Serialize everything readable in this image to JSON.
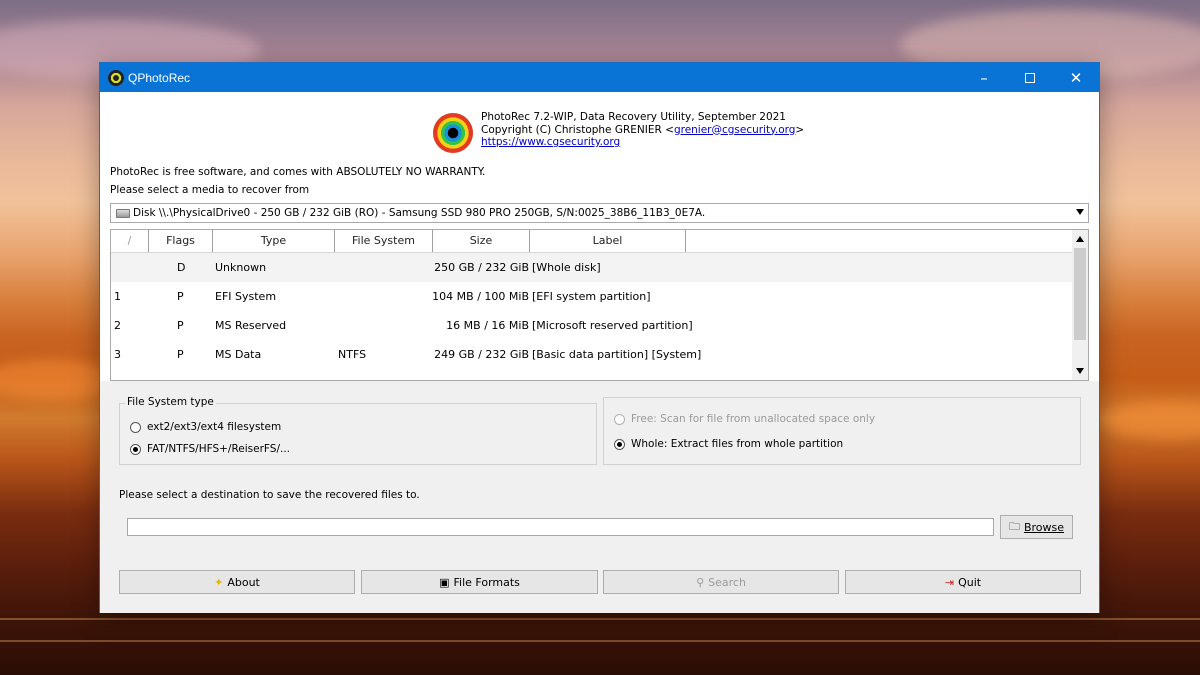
{
  "window": {
    "title": "QPhotoRec",
    "controls": {
      "minimize": "–",
      "close": "✕"
    }
  },
  "header": {
    "line1": "PhotoRec 7.2-WIP, Data Recovery Utility, September 2021",
    "line2_prefix": "Copyright (C) Christophe GRENIER <",
    "email": "grenier@cgsecurity.org",
    "line2_suffix": ">",
    "website": "https://www.cgsecurity.org"
  },
  "notice": "PhotoRec is free software, and comes with ABSOLUTELY NO WARRANTY.",
  "media_prompt": "Please select a media to recover from",
  "disk_select": {
    "value": "Disk \\\\.\\PhysicalDrive0 - 250 GB / 232 GiB (RO) - Samsung SSD 980 PRO 250GB, S/N:0025_38B6_11B3_0E7A."
  },
  "table": {
    "headers": [
      "/",
      "Flags",
      "Type",
      "File System",
      "Size",
      "Label"
    ],
    "rows": [
      {
        "num": "",
        "flags": "D",
        "type": "Unknown",
        "fs": "",
        "size": "250 GB / 232 GiB",
        "label": "[Whole disk]"
      },
      {
        "num": "1",
        "flags": "P",
        "type": "EFI System",
        "fs": "",
        "size": "104 MB / 100 MiB",
        "label": "[EFI system partition]"
      },
      {
        "num": "2",
        "flags": "P",
        "type": "MS Reserved",
        "fs": "",
        "size": "16 MB / 16 MiB",
        "label": "[Microsoft reserved partition]"
      },
      {
        "num": "3",
        "flags": "P",
        "type": "MS Data",
        "fs": "NTFS",
        "size": "249 GB / 232 GiB",
        "label": "[Basic data partition] [System]"
      }
    ]
  },
  "fs_type": {
    "legend": "File System type",
    "option_ext": "ext2/ext3/ext4 filesystem",
    "option_fat": "FAT/NTFS/HFS+/ReiserFS/...",
    "selected": "fat"
  },
  "scan_mode": {
    "option_free": "Free: Scan for file from unallocated space only",
    "option_whole": "Whole: Extract files from whole partition",
    "selected": "whole"
  },
  "destination": {
    "prompt": "Please select a destination to save the recovered files to.",
    "value": "",
    "browse_label": "Browse"
  },
  "buttons": {
    "about": "About",
    "file_formats": "File Formats",
    "search": "Search",
    "quit": "Quit"
  },
  "colors": {
    "titlebar": "#0a74d6",
    "link": "#0000cc",
    "disabled_text": "#9a9a9a"
  }
}
